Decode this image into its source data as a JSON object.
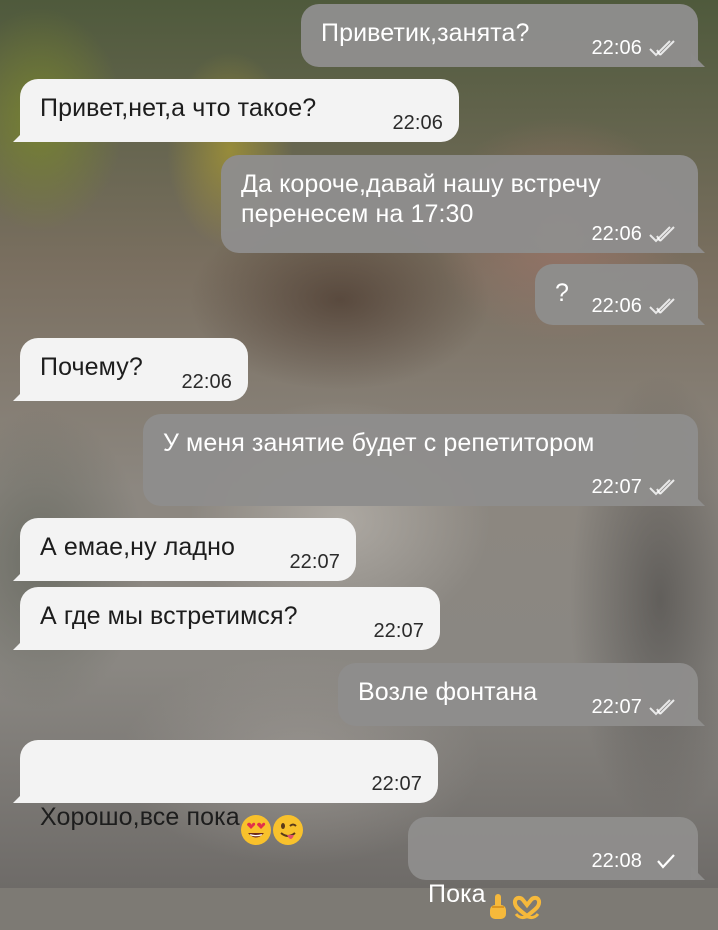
{
  "messages": [
    {
      "dir": "out",
      "text": "Приветик,занята?",
      "time": "22:06",
      "status": "read"
    },
    {
      "dir": "in",
      "text": "Привет,нет,а что такое?",
      "time": "22:06"
    },
    {
      "dir": "out",
      "text": "Да короче,давай нашу встречу\nперенесем на 17:30",
      "time": "22:06",
      "status": "read"
    },
    {
      "dir": "out",
      "text": "?",
      "time": "22:06",
      "status": "read"
    },
    {
      "dir": "in",
      "text": "Почему?",
      "time": "22:06"
    },
    {
      "dir": "out",
      "text": "У меня занятие будет с репетитором",
      "time": "22:07",
      "status": "read"
    },
    {
      "dir": "in",
      "text": "А емае,ну ладно",
      "time": "22:07"
    },
    {
      "dir": "in",
      "text": "А где мы встретимся?",
      "time": "22:07"
    },
    {
      "dir": "out",
      "text": "Возле фонтана",
      "time": "22:07",
      "status": "read"
    },
    {
      "dir": "in",
      "text": "Хорошо,все пока",
      "time": "22:07",
      "emoji": [
        "heart-eyes-emoji",
        "winking-tongue-emoji"
      ]
    },
    {
      "dir": "out",
      "text": "Пока",
      "time": "22:08",
      "status": "sent",
      "emoji": [
        "middle-finger-emoji",
        "heart-hands-emoji"
      ]
    }
  ],
  "colors": {
    "incoming_bubble": "#f3f3f3",
    "outgoing_bubble": "#8d8c8b",
    "incoming_text": "#1d1d1d",
    "outgoing_text": "#ffffff"
  },
  "icons": {
    "read": "double-check-icon",
    "sent": "single-check-icon"
  }
}
